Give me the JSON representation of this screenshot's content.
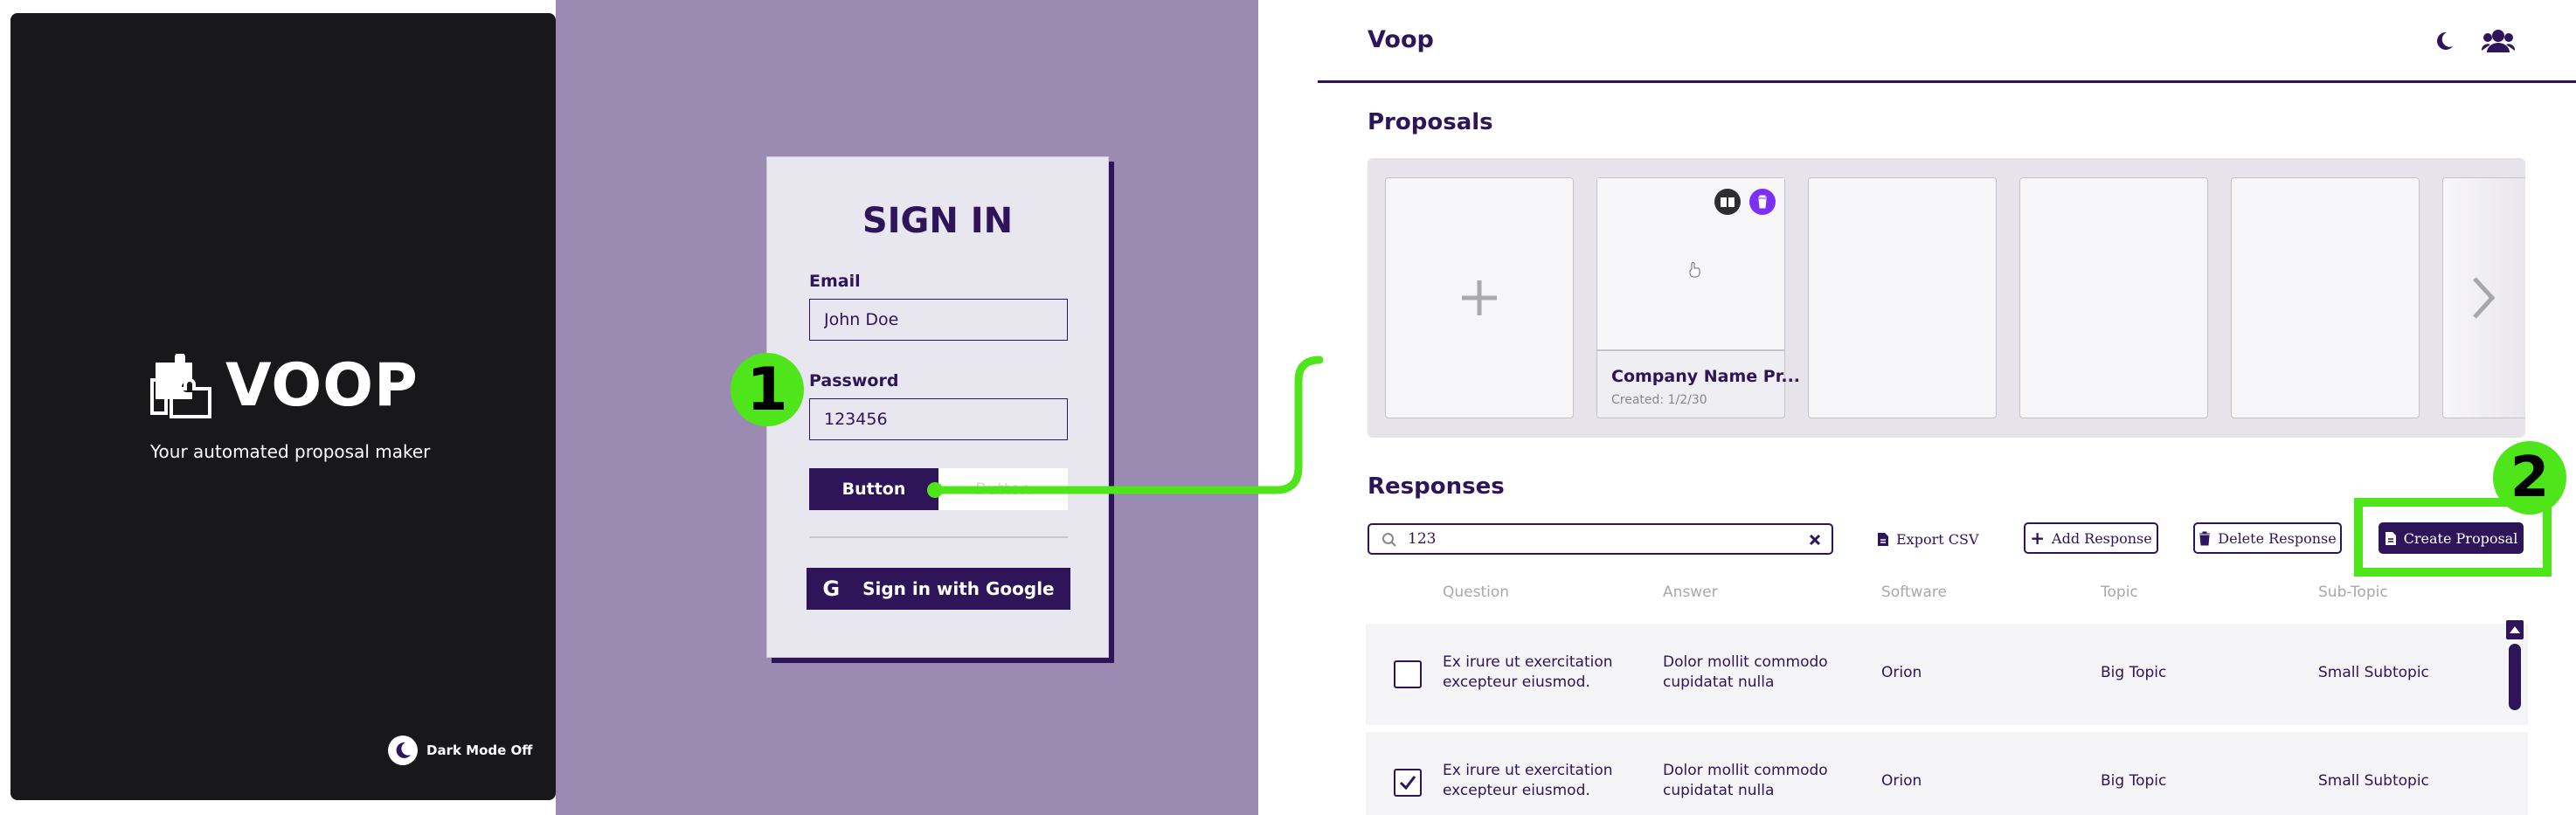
{
  "left": {
    "brand": "VOOP",
    "tagline": "Your automated proposal maker",
    "dark_mode_label": "Dark Mode Off"
  },
  "signin": {
    "title": "SIGN IN",
    "email_label": "Email",
    "email_value": "John Doe",
    "password_label": "Password",
    "password_value": "123456",
    "primary_button": "Button",
    "secondary_button": "Button",
    "google_button": "Sign in with Google"
  },
  "badges": [
    "1",
    "2"
  ],
  "header": {
    "title": "Voop"
  },
  "proposals": {
    "title": "Proposals",
    "items": [
      {
        "name": "Company Name Pr...",
        "created": "Created: 1/2/30"
      }
    ]
  },
  "responses": {
    "title": "Responses",
    "search_value": "123",
    "export_label": "Export CSV",
    "add_label": "Add Response",
    "delete_label": "Delete Response",
    "create_label": "Create Proposal",
    "columns": [
      "Question",
      "Answer",
      "Software",
      "Topic",
      "Sub-Topic"
    ],
    "rows": [
      {
        "checked": false,
        "question": "Ex irure ut exercitation excepteur eiusmod.",
        "answer": "Dolor mollit commodo cupidatat nulla",
        "software": "Orion",
        "topic": "Big Topic",
        "subtopic": "Small Subtopic"
      },
      {
        "checked": true,
        "question": "Ex irure ut exercitation excepteur eiusmod.",
        "answer": "Dolor mollit commodo cupidatat nulla",
        "software": "Orion",
        "topic": "Big Topic",
        "subtopic": "Small Subtopic"
      }
    ]
  },
  "colors": {
    "primary": "#2e1459",
    "accent": "#4fe51b",
    "panel": "#18171a",
    "backdrop": "#9b8bb3",
    "violet": "#7b2ff7"
  }
}
